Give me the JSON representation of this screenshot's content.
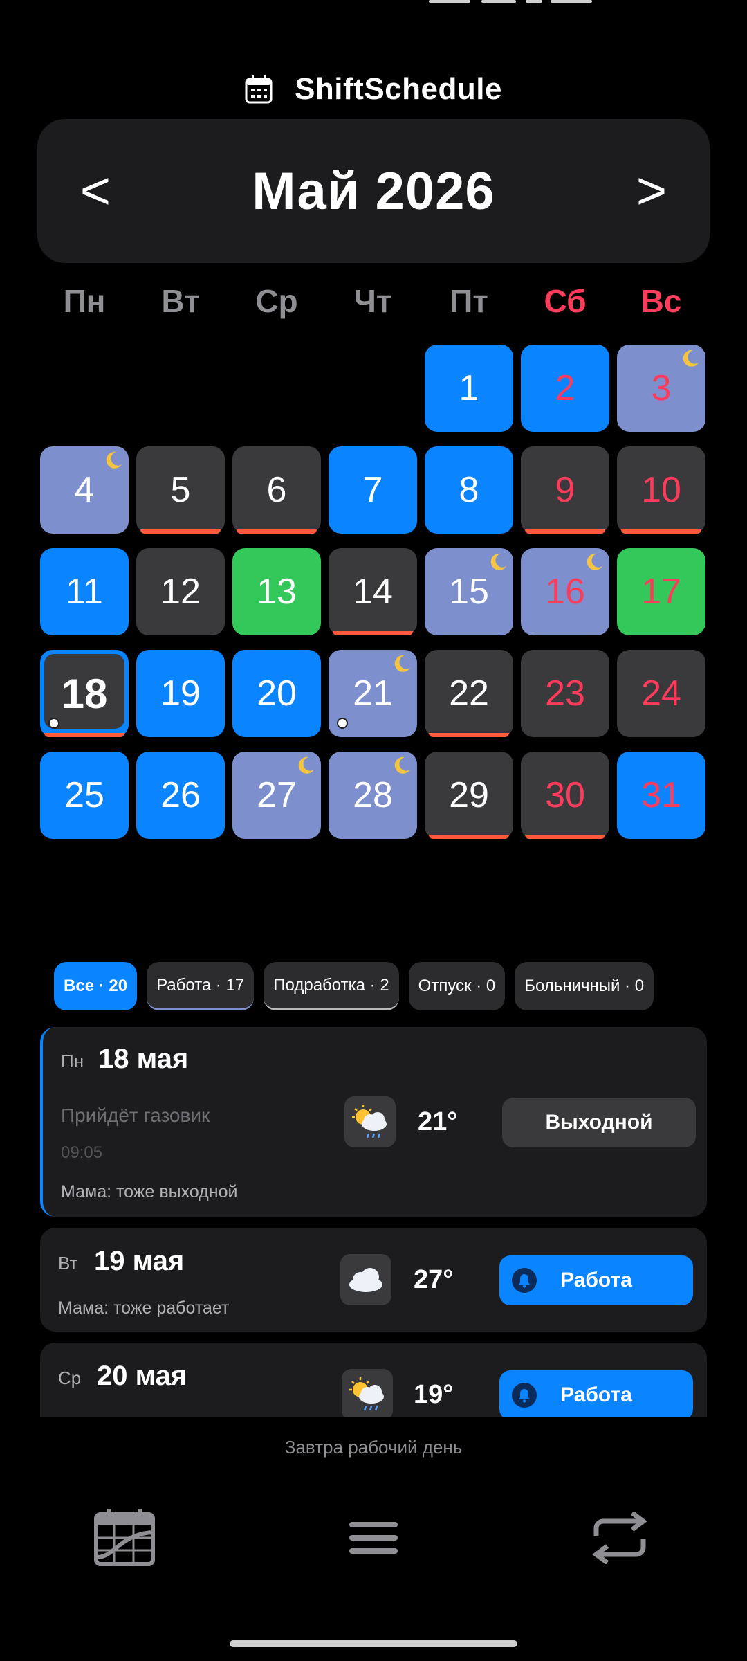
{
  "app": {
    "title": "ShiftSchedule"
  },
  "month": {
    "label": "Май 2026",
    "prev_label": "<",
    "next_label": ">"
  },
  "weekdays": [
    "Пн",
    "Вт",
    "Ср",
    "Чт",
    "Пт",
    "Сб",
    "Вс"
  ],
  "days": [
    {
      "n": "1",
      "type": "work"
    },
    {
      "n": "2",
      "type": "work",
      "red": true
    },
    {
      "n": "3",
      "type": "night",
      "red": true,
      "moon": true
    },
    {
      "n": "4",
      "type": "night",
      "moon": true
    },
    {
      "n": "5",
      "type": "off",
      "underline": true
    },
    {
      "n": "6",
      "type": "off",
      "underline": true
    },
    {
      "n": "7",
      "type": "work"
    },
    {
      "n": "8",
      "type": "work"
    },
    {
      "n": "9",
      "type": "off",
      "red": true,
      "underline": true
    },
    {
      "n": "10",
      "type": "off",
      "red": true,
      "underline": true
    },
    {
      "n": "11",
      "type": "work"
    },
    {
      "n": "12",
      "type": "off"
    },
    {
      "n": "13",
      "type": "side"
    },
    {
      "n": "14",
      "type": "off",
      "underline": true
    },
    {
      "n": "15",
      "type": "night",
      "moon": true
    },
    {
      "n": "16",
      "type": "night",
      "red": true,
      "moon": true
    },
    {
      "n": "17",
      "type": "side",
      "red": true
    },
    {
      "n": "18",
      "type": "today",
      "underline": true,
      "dot": true
    },
    {
      "n": "19",
      "type": "work"
    },
    {
      "n": "20",
      "type": "work"
    },
    {
      "n": "21",
      "type": "night",
      "moon": true,
      "dot": true
    },
    {
      "n": "22",
      "type": "off",
      "underline": true
    },
    {
      "n": "23",
      "type": "off",
      "red": true
    },
    {
      "n": "24",
      "type": "off",
      "red": true
    },
    {
      "n": "25",
      "type": "work"
    },
    {
      "n": "26",
      "type": "work"
    },
    {
      "n": "27",
      "type": "night",
      "moon": true
    },
    {
      "n": "28",
      "type": "night",
      "moon": true
    },
    {
      "n": "29",
      "type": "off",
      "underline": true
    },
    {
      "n": "30",
      "type": "off",
      "red": true,
      "underline": true
    },
    {
      "n": "31",
      "type": "work",
      "red": true
    }
  ],
  "first_weekday_index": 4,
  "filters": [
    {
      "label": "Все · 20",
      "active": true
    },
    {
      "label": "Работа · 17",
      "style": "night"
    },
    {
      "label": "Подработка · 2",
      "style": "side"
    },
    {
      "label": "Отпуск · 0"
    },
    {
      "label": "Больничный · 0"
    }
  ],
  "entries": {
    "e1": {
      "dow": "Пн",
      "date": "18 мая",
      "event": "Прийдёт газовик",
      "time": "09:05",
      "note": "Мама: тоже выходной",
      "weather_icon": "sun-cloud-rain-icon",
      "temp": "21°",
      "shift": "Выходной"
    },
    "e2": {
      "dow": "Вт",
      "date": "19 мая",
      "note": "Мама: тоже работает",
      "weather_icon": "cloud-icon",
      "temp": "27°",
      "shift": "Работа"
    },
    "e3": {
      "dow": "Ср",
      "date": "20 мая",
      "weather_icon": "sun-cloud-rain-icon",
      "temp": "19°",
      "shift": "Работа"
    }
  },
  "footer_hint": "Завтра рабочий день",
  "colors": {
    "work": "#0a84ff",
    "off": "#3a3a3c",
    "night": "#7d8fcd",
    "side": "#34c759",
    "weekend_text": "#ff3b5c",
    "underline": "#ff5a3c"
  }
}
